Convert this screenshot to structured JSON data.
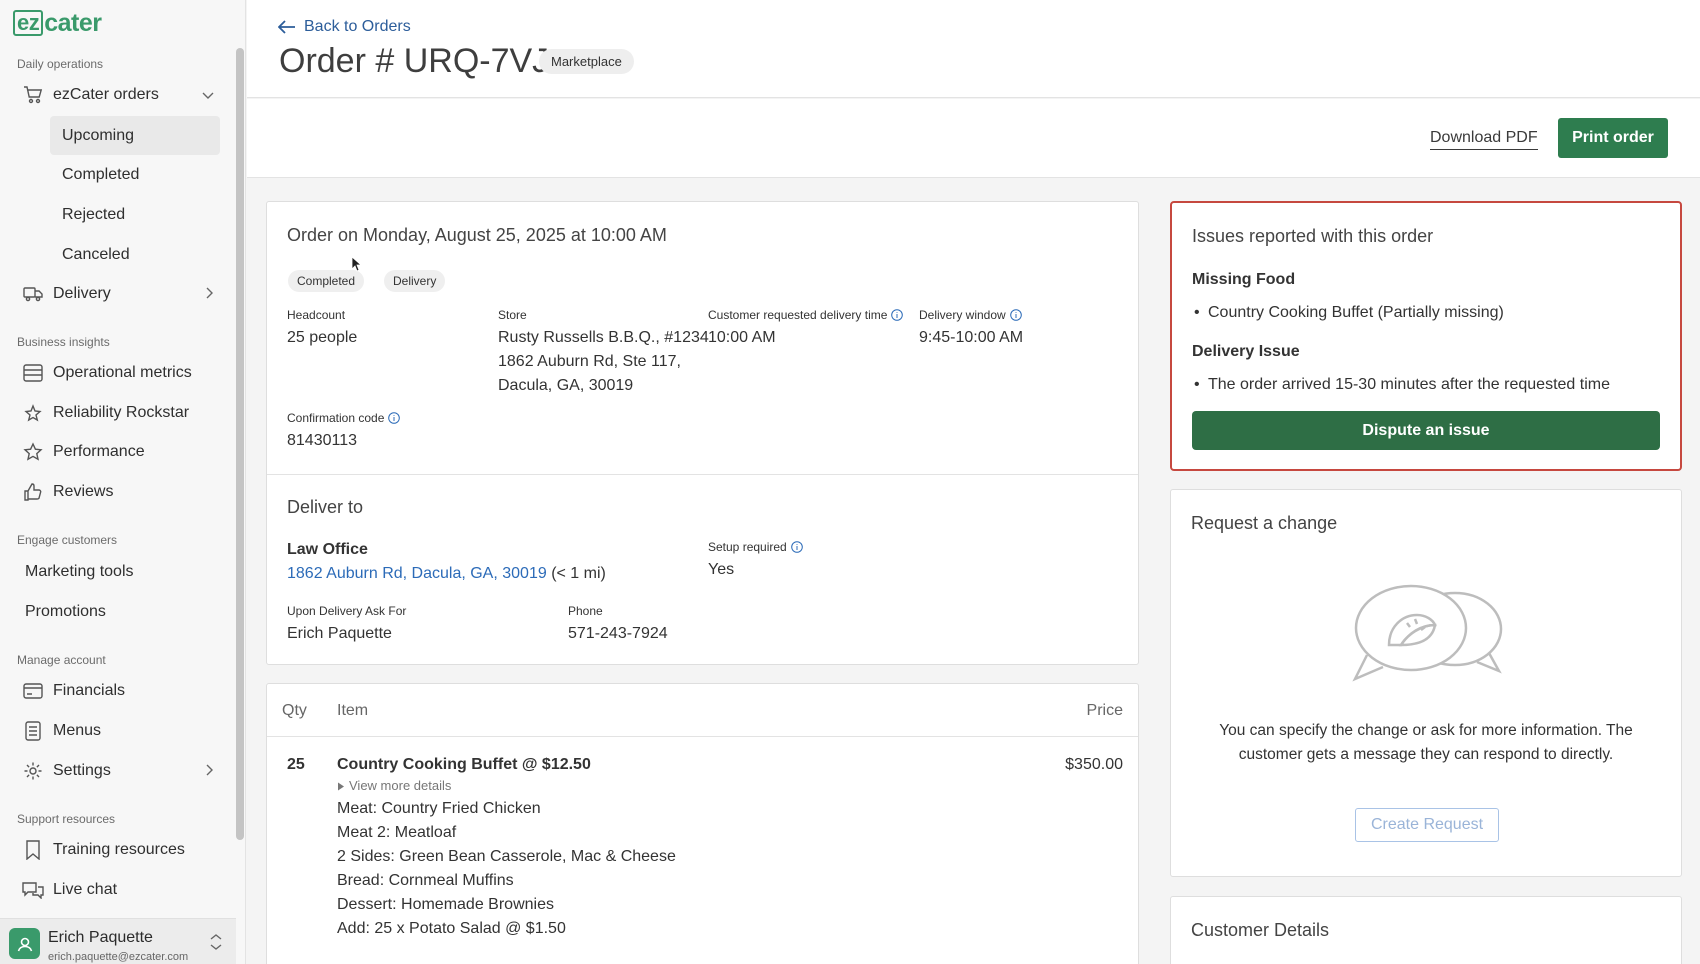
{
  "sidebar": {
    "logo_ez": "ez",
    "logo_cater": "cater",
    "sections": {
      "daily": "Daily operations",
      "business": "Business insights",
      "engage": "Engage customers",
      "manage": "Manage account",
      "support": "Support resources"
    },
    "ezcater_orders": "ezCater orders",
    "sub_items": [
      "Upcoming",
      "Completed",
      "Rejected",
      "Canceled"
    ],
    "delivery": "Delivery",
    "business_items": [
      "Operational metrics",
      "Reliability Rockstar",
      "Performance",
      "Reviews"
    ],
    "engage_items": [
      "Marketing tools",
      "Promotions"
    ],
    "manage_items": [
      "Financials",
      "Menus",
      "Settings"
    ],
    "support_items": [
      "Training resources",
      "Live chat"
    ],
    "user": {
      "name": "Erich Paquette",
      "email": "erich.paquette@ezcater.com"
    }
  },
  "header": {
    "back": "Back to Orders",
    "title": "Order # URQ-7VJ",
    "badge": "Marketplace"
  },
  "actions": {
    "download": "Download PDF",
    "print": "Print order"
  },
  "order": {
    "heading": "Order on Monday, August 25, 2025 at 10:00 AM",
    "status": "Completed",
    "type": "Delivery",
    "headcount_label": "Headcount",
    "headcount": "25 people",
    "store_label": "Store",
    "store_lines": [
      "Rusty Russells B.B.Q., #1234",
      "1862 Auburn Rd, Ste 117,",
      "Dacula, GA, 30019"
    ],
    "req_time_label": "Customer requested delivery time",
    "req_time": "10:00 AM",
    "window_label": "Delivery window",
    "window": "9:45-10:00 AM",
    "conf_label": "Confirmation code",
    "conf": "81430113"
  },
  "deliver": {
    "heading": "Deliver to",
    "place": "Law Office",
    "address": "1862 Auburn Rd, Dacula, GA, 30019",
    "distance": "(< 1 mi)",
    "setup_label": "Setup required",
    "setup": "Yes",
    "ask_label": "Upon Delivery Ask For",
    "ask": "Erich Paquette",
    "phone_label": "Phone",
    "phone": "571-243-7924"
  },
  "items": {
    "headers": {
      "qty": "Qty",
      "item": "Item",
      "price": "Price"
    },
    "row": {
      "qty": "25",
      "name": "Country Cooking Buffet @ $12.50",
      "price": "$350.00",
      "more": "View more details",
      "details": [
        "Meat: Country Fried Chicken",
        "Meat 2: Meatloaf",
        "2 Sides: Green Bean Casserole, Mac & Cheese",
        "Bread: Cornmeal Muffins",
        "Dessert: Homemade Brownies",
        "Add: 25 x Potato Salad @ $1.50"
      ]
    }
  },
  "issues": {
    "heading": "Issues reported with this order",
    "cat1": "Missing Food",
    "item1": "Country Cooking Buffet (Partially missing)",
    "cat2": "Delivery Issue",
    "item2": "The order arrived 15-30 minutes after the requested time",
    "button": "Dispute an issue"
  },
  "request": {
    "heading": "Request a change",
    "text1": "You can specify the change or ask for more information. The",
    "text2": "customer gets a message they can respond to directly.",
    "button": "Create Request"
  },
  "customer": {
    "heading": "Customer Details"
  },
  "colors": {
    "brand": "#3a9a6b",
    "primary_button": "#2e7d4f",
    "issue_border": "#c6483f",
    "link": "#2c6bb8"
  }
}
